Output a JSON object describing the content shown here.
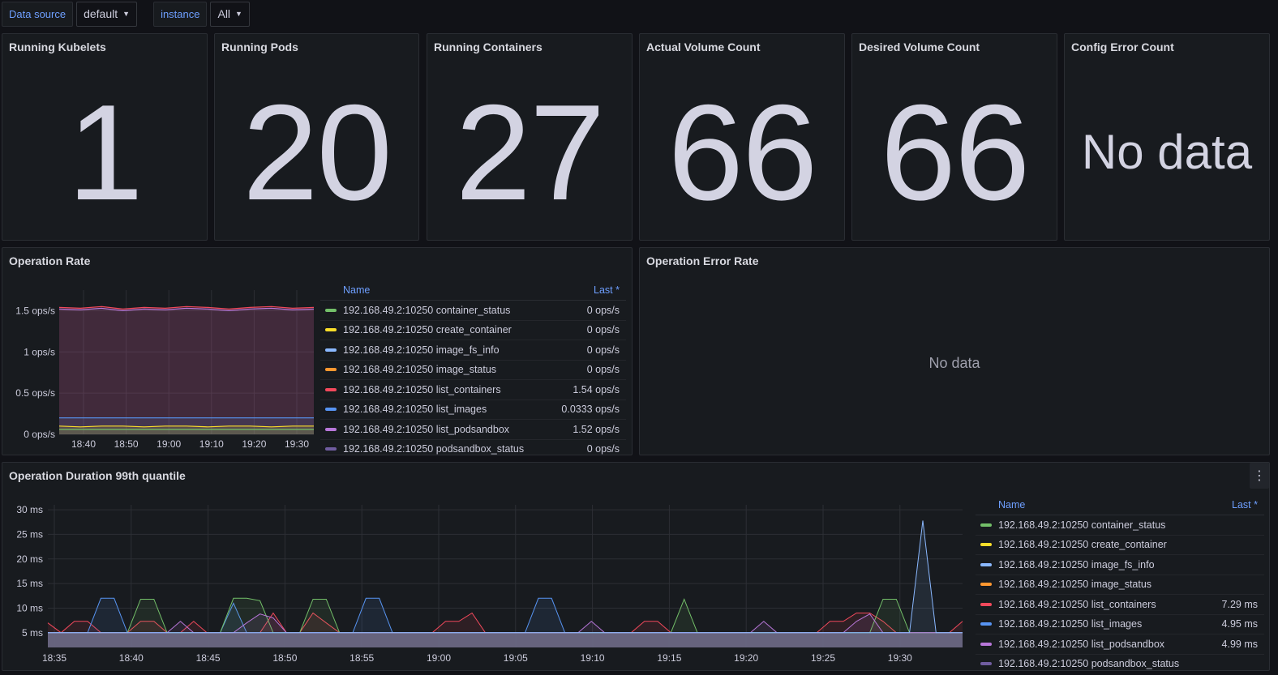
{
  "variables": {
    "datasource_label": "Data source",
    "datasource_value": "default",
    "instance_label": "instance",
    "instance_value": "All"
  },
  "stats": [
    {
      "title": "Running Kubelets",
      "value": "1"
    },
    {
      "title": "Running Pods",
      "value": "20"
    },
    {
      "title": "Running Containers",
      "value": "27"
    },
    {
      "title": "Actual Volume Count",
      "value": "66"
    },
    {
      "title": "Desired Volume Count",
      "value": "66"
    },
    {
      "title": "Config Error Count",
      "value": "No data"
    }
  ],
  "colors": {
    "container_status": "#73bf69",
    "create_container": "#fade2a",
    "image_fs_info": "#8ab8ff",
    "image_status": "#ff9830",
    "list_containers": "#f2495c",
    "list_images": "#5794f2",
    "list_podsandbox": "#b877d9",
    "podsandbox_status": "#705da0"
  },
  "operation_rate": {
    "title": "Operation Rate",
    "legend_name_header": "Name",
    "legend_value_header": "Last *",
    "legend": [
      {
        "name": "192.168.49.2:10250 container_status",
        "value": "0 ops/s",
        "color": "#73bf69"
      },
      {
        "name": "192.168.49.2:10250 create_container",
        "value": "0 ops/s",
        "color": "#fade2a"
      },
      {
        "name": "192.168.49.2:10250 image_fs_info",
        "value": "0 ops/s",
        "color": "#8ab8ff"
      },
      {
        "name": "192.168.49.2:10250 image_status",
        "value": "0 ops/s",
        "color": "#ff9830"
      },
      {
        "name": "192.168.49.2:10250 list_containers",
        "value": "1.54 ops/s",
        "color": "#f2495c"
      },
      {
        "name": "192.168.49.2:10250 list_images",
        "value": "0.0333 ops/s",
        "color": "#5794f2"
      },
      {
        "name": "192.168.49.2:10250 list_podsandbox",
        "value": "1.52 ops/s",
        "color": "#b877d9"
      },
      {
        "name": "192.168.49.2:10250 podsandbox_status",
        "value": "0 ops/s",
        "color": "#705da0"
      }
    ]
  },
  "operation_error_rate": {
    "title": "Operation Error Rate",
    "nodata": "No data"
  },
  "operation_duration": {
    "title": "Operation Duration 99th quantile",
    "menu_icon": "kebab-menu-icon",
    "legend_name_header": "Name",
    "legend_value_header": "Last *",
    "legend": [
      {
        "name": "192.168.49.2:10250 container_status",
        "value": "",
        "color": "#73bf69"
      },
      {
        "name": "192.168.49.2:10250 create_container",
        "value": "",
        "color": "#fade2a"
      },
      {
        "name": "192.168.49.2:10250 image_fs_info",
        "value": "",
        "color": "#8ab8ff"
      },
      {
        "name": "192.168.49.2:10250 image_status",
        "value": "",
        "color": "#ff9830"
      },
      {
        "name": "192.168.49.2:10250 list_containers",
        "value": "7.29 ms",
        "color": "#f2495c"
      },
      {
        "name": "192.168.49.2:10250 list_images",
        "value": "4.95 ms",
        "color": "#5794f2"
      },
      {
        "name": "192.168.49.2:10250 list_podsandbox",
        "value": "4.99 ms",
        "color": "#b877d9"
      },
      {
        "name": "192.168.49.2:10250 podsandbox_status",
        "value": "",
        "color": "#705da0"
      }
    ]
  },
  "chart_data": [
    {
      "type": "area",
      "title": "Operation Rate",
      "x_ticks": [
        "18:40",
        "18:50",
        "19:00",
        "19:10",
        "19:20",
        "19:30"
      ],
      "y_ticks": [
        "0 ops/s",
        "0.5 ops/s",
        "1 ops/s",
        "1.5 ops/s"
      ],
      "ylim": [
        0,
        1.75
      ],
      "grid": true,
      "series": [
        {
          "name": "192.168.49.2:10250 list_containers",
          "values": [
            1.54,
            1.53,
            1.55,
            1.52,
            1.54,
            1.53,
            1.55,
            1.54,
            1.52,
            1.54,
            1.55,
            1.53,
            1.54
          ]
        },
        {
          "name": "192.168.49.2:10250 list_podsandbox",
          "values": [
            1.52,
            1.51,
            1.53,
            1.5,
            1.52,
            1.51,
            1.53,
            1.52,
            1.5,
            1.52,
            1.53,
            1.51,
            1.52
          ]
        },
        {
          "name": "192.168.49.2:10250 list_images",
          "values": [
            0.2,
            0.2,
            0.2,
            0.2,
            0.2,
            0.2,
            0.2,
            0.2,
            0.2,
            0.2,
            0.2,
            0.2,
            0.2
          ]
        },
        {
          "name": "192.168.49.2:10250 create_container",
          "values": [
            0.1,
            0.09,
            0.1,
            0.1,
            0.09,
            0.1,
            0.1,
            0.09,
            0.1,
            0.1,
            0.09,
            0.1,
            0.1
          ]
        },
        {
          "name": "192.168.49.2:10250 container_status",
          "values": [
            0.06,
            0.06,
            0.06,
            0.06,
            0.06,
            0.06,
            0.06,
            0.06,
            0.06,
            0.06,
            0.06,
            0.06,
            0.06
          ]
        }
      ]
    },
    {
      "type": "area",
      "title": "Operation Duration 99th quantile",
      "x_ticks": [
        "18:35",
        "18:40",
        "18:45",
        "18:50",
        "18:55",
        "19:00",
        "19:05",
        "19:10",
        "19:15",
        "19:20",
        "19:25",
        "19:30"
      ],
      "y_ticks": [
        "5 ms",
        "10 ms",
        "15 ms",
        "20 ms",
        "25 ms",
        "30 ms"
      ],
      "ylim": [
        2,
        31
      ],
      "grid": true,
      "x_minutes": [
        0,
        1,
        2,
        3,
        4,
        5,
        6,
        7,
        8,
        9,
        10,
        11,
        12,
        13,
        14,
        15,
        16,
        17,
        18,
        19,
        20,
        21,
        22,
        23,
        24,
        25,
        26,
        27,
        28,
        29,
        30,
        31,
        32,
        33,
        34,
        35,
        36,
        37,
        38,
        39,
        40,
        41,
        42,
        43,
        44,
        45,
        46,
        47,
        48,
        49,
        50,
        51,
        52,
        53,
        54,
        55,
        56,
        57,
        58,
        59,
        60,
        61,
        62,
        63
      ],
      "series": [
        {
          "name": "192.168.49.2:10250 list_containers",
          "values": [
            7,
            5,
            7.3,
            7.3,
            5,
            5,
            5,
            7.3,
            7.3,
            5,
            5,
            7.3,
            5,
            5,
            5,
            5,
            5,
            9,
            5,
            5,
            9,
            7,
            5,
            5,
            5,
            5,
            5,
            5,
            5,
            5,
            7.3,
            7.3,
            9,
            5,
            5,
            5,
            5,
            5,
            5,
            5,
            5,
            5,
            5,
            5,
            5,
            7.3,
            7.3,
            5,
            5,
            5,
            5,
            5,
            5,
            5,
            5,
            5,
            5,
            5,
            5,
            7.3,
            7.3,
            9,
            9,
            7.3,
            5,
            5,
            5,
            5,
            5,
            7.3
          ]
        },
        {
          "name": "192.168.49.2:10250 list_images",
          "values": [
            5,
            5,
            5,
            5,
            12,
            12,
            5,
            5,
            5,
            5,
            5,
            5,
            5,
            5,
            11,
            5,
            5,
            5,
            5,
            5,
            5,
            5,
            5,
            5,
            12,
            12,
            5,
            5,
            5,
            5,
            5,
            5,
            5,
            5,
            5,
            5,
            5,
            12,
            12,
            5,
            5,
            5,
            5,
            5,
            5,
            5,
            5,
            5,
            5,
            5,
            5,
            5,
            5,
            5,
            5,
            5,
            5,
            5,
            5,
            5,
            5,
            5,
            5,
            5,
            5,
            5,
            5,
            5,
            5,
            5
          ]
        },
        {
          "name": "192.168.49.2:10250 container_status",
          "values": [
            5,
            5,
            5,
            5,
            5,
            5,
            5,
            11.8,
            11.8,
            5,
            5,
            5,
            5,
            5,
            12,
            12,
            11.5,
            5,
            5,
            5,
            11.8,
            11.8,
            5,
            5,
            5,
            5,
            5,
            5,
            5,
            5,
            5,
            5,
            5,
            5,
            5,
            5,
            5,
            5,
            5,
            5,
            5,
            5,
            5,
            5,
            5,
            5,
            5,
            5,
            11.8,
            5,
            5,
            5,
            5,
            5,
            5,
            5,
            5,
            5,
            5,
            5,
            5,
            5,
            5,
            11.8,
            11.8,
            5,
            5,
            5,
            5,
            5
          ]
        },
        {
          "name": "192.168.49.2:10250 list_podsandbox",
          "values": [
            5,
            5,
            5,
            5,
            5,
            5,
            5,
            5,
            5,
            5,
            7.3,
            5,
            5,
            5,
            5,
            7,
            8.8,
            8,
            5,
            5,
            5,
            5,
            5,
            5,
            5,
            5,
            5,
            5,
            5,
            5,
            5,
            5,
            5,
            5,
            5,
            5,
            5,
            5,
            5,
            5,
            5,
            7.3,
            5,
            5,
            5,
            5,
            5,
            5,
            5,
            5,
            5,
            5,
            5,
            5,
            7.3,
            5,
            5,
            5,
            5,
            5,
            5,
            7.3,
            8.8,
            5,
            5,
            5,
            5,
            5,
            5,
            5
          ]
        },
        {
          "name": "192.168.49.2:10250 image_fs_info",
          "values": [
            5,
            5,
            5,
            5,
            5,
            5,
            5,
            5,
            5,
            5,
            5,
            5,
            5,
            5,
            5,
            5,
            5,
            5,
            5,
            5,
            5,
            5,
            5,
            5,
            5,
            5,
            5,
            5,
            5,
            5,
            5,
            5,
            5,
            5,
            5,
            5,
            5,
            5,
            5,
            5,
            5,
            5,
            5,
            5,
            5,
            5,
            5,
            5,
            5,
            5,
            5,
            5,
            5,
            5,
            5,
            5,
            5,
            5,
            5,
            5,
            5,
            5,
            5,
            5,
            5,
            5,
            27.8,
            5,
            5,
            5
          ]
        }
      ]
    }
  ]
}
